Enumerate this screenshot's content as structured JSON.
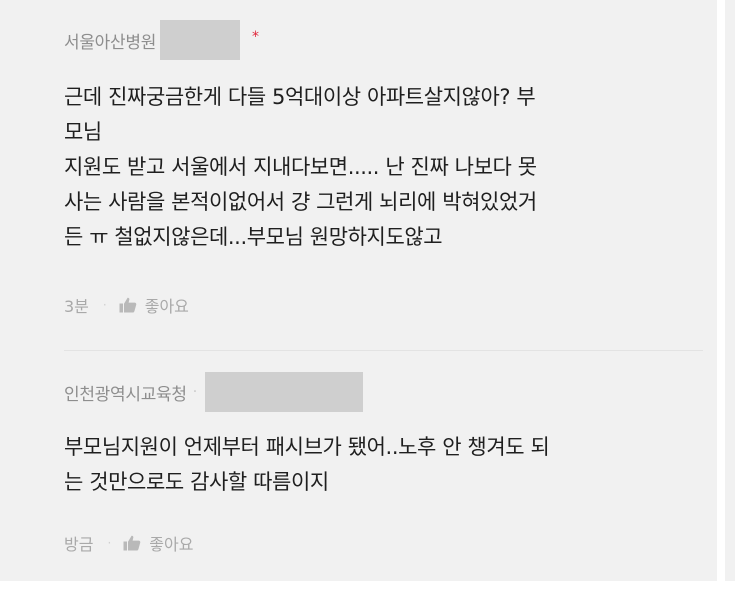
{
  "comments": [
    {
      "author": "서울아산병원",
      "has_star": true,
      "star": "*",
      "body": "근데 진짜궁금한게 다들 5억대이상 아파트살지않아? 부\n모님\n지원도 받고 서울에서 지내다보면..... 난 진짜 나보다 못\n사는 사람을 본적이없어서 걍 그런게 뇌리에 박혀있었거\n든 ㅠ 철없지않은데...부모님 원망하지도않고",
      "time": "3분",
      "like_label": "좋아요"
    },
    {
      "author": "인천광역시교육청",
      "has_star": false,
      "sep": "·",
      "body": "부모님지원이 언제부터 패시브가 됐어..노후 안 챙겨도 되\n는 것만으로도 감사할 따름이지",
      "time": "방금",
      "like_label": "좋아요"
    }
  ],
  "meta_separator": "·",
  "icons": {
    "like": "thumbs-up-icon"
  },
  "colors": {
    "panel": "#f1f1f1",
    "star": "#e0263a",
    "meta": "#a9a9a9",
    "text": "#1f1f1f"
  }
}
